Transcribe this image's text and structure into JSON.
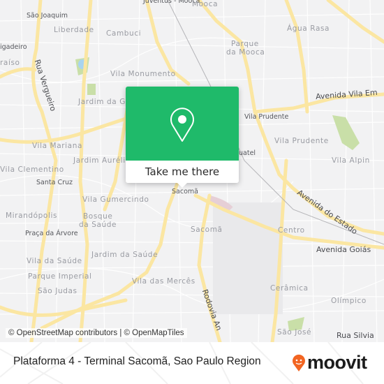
{
  "map": {
    "labels": {
      "juventus_mooca": "Juventus - Mooca",
      "mooca": "Mooca",
      "sao_joaquim": "São Joaquim",
      "liberdade": "Liberdade",
      "cambuci": "Cambuci",
      "agua_rasa": "Água Rasa",
      "parque_mooca_1": "Parque",
      "parque_mooca_2": "da Mooca",
      "brigadeiro": "igadeiro",
      "paraiso": "raíso",
      "rua_vergueiro": "Rua Vergueiro",
      "vila_monumento": "Vila Monumento",
      "jardim_gloria": "Jardim da Gló",
      "avenida_vila_ema": "Avenida Vila Em",
      "vila_prudente_1": "Vila Prudente",
      "vila_prudente_2": "Vila Prudente",
      "vila_mariana": "Vila Mariana",
      "jardim_aurelia": "Jardim Aurélia",
      "quatel": "uatel",
      "vila_alpina": "Vila Alpin",
      "vila_clementino": "Vila Clementino",
      "santa_cruz": "Santa Cruz",
      "sacoma_station": "Sacomã",
      "vila_gumercindo": "Vila Gumercindo",
      "avenida_estado": "Avenida do Estado",
      "mirandopolis": "Mirandópolis",
      "bosque_1": "Bosque",
      "bosque_2": "da Saúde",
      "praca_arvore": "Praça da Árvore",
      "sacoma": "Sacomã",
      "centro": "Centro",
      "avenida_goias": "Avenida Goiás",
      "jardim_saude": "Jardim da Saúde",
      "vila_saude": "Vila da Saúde",
      "parque_imperial": "Parque Imperial",
      "vila_merces": "Vila das Mercês",
      "sao_judas": "São Judas",
      "rodovia_anchieta": "Rodovia An",
      "ceramica": "Cerâmica",
      "olimpico": "Olímpico",
      "sao_jose": "São José",
      "rua_silvia": "Rua Silvia"
    },
    "attribution": "© OpenStreetMap contributors | © OpenMapTiles",
    "colors": {
      "major_road": "#fbe6a2",
      "park": "#c9dfa8",
      "water": "#a8d4f0",
      "background": "#f2f2f3"
    }
  },
  "popup": {
    "icon": "map-pin-icon",
    "button_label": "Take me there",
    "color": "#1fba6a"
  },
  "footer": {
    "title": "Plataforma 4 - Terminal Sacomã, Sao Paulo Region",
    "logo_text": "moovit",
    "logo_color": "#f26522"
  }
}
